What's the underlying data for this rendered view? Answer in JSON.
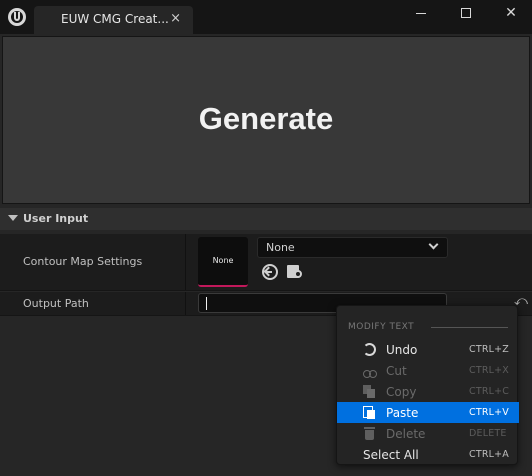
{
  "window": {
    "tab_title": "EUW CMG Creat...",
    "close_glyph": "×",
    "minimize_glyph": "",
    "close_window_glyph": "✕"
  },
  "main": {
    "generate_label": "Generate"
  },
  "section": {
    "title": "User Input"
  },
  "properties": {
    "contour": {
      "label": "Contour Map Settings",
      "thumbnail_text": "None",
      "combo_value": "None"
    },
    "output": {
      "label": "Output Path",
      "value": ""
    }
  },
  "context_menu": {
    "heading": "MODIFY TEXT",
    "items": [
      {
        "label": "Undo",
        "shortcut": "CTRL+Z",
        "enabled": true,
        "icon": "undo-icon"
      },
      {
        "label": "Cut",
        "shortcut": "CTRL+X",
        "enabled": false,
        "icon": "cut-icon"
      },
      {
        "label": "Copy",
        "shortcut": "CTRL+C",
        "enabled": false,
        "icon": "copy-icon"
      },
      {
        "label": "Paste",
        "shortcut": "CTRL+V",
        "enabled": true,
        "highlighted": true,
        "icon": "paste-icon"
      },
      {
        "label": "Delete",
        "shortcut": "DELETE",
        "enabled": false,
        "icon": "delete-icon"
      },
      {
        "label": "Select All",
        "shortcut": "CTRL+A",
        "enabled": true
      }
    ]
  },
  "colors": {
    "accent_highlight": "#0070e0",
    "thumbnail_underline": "#c2185b"
  }
}
